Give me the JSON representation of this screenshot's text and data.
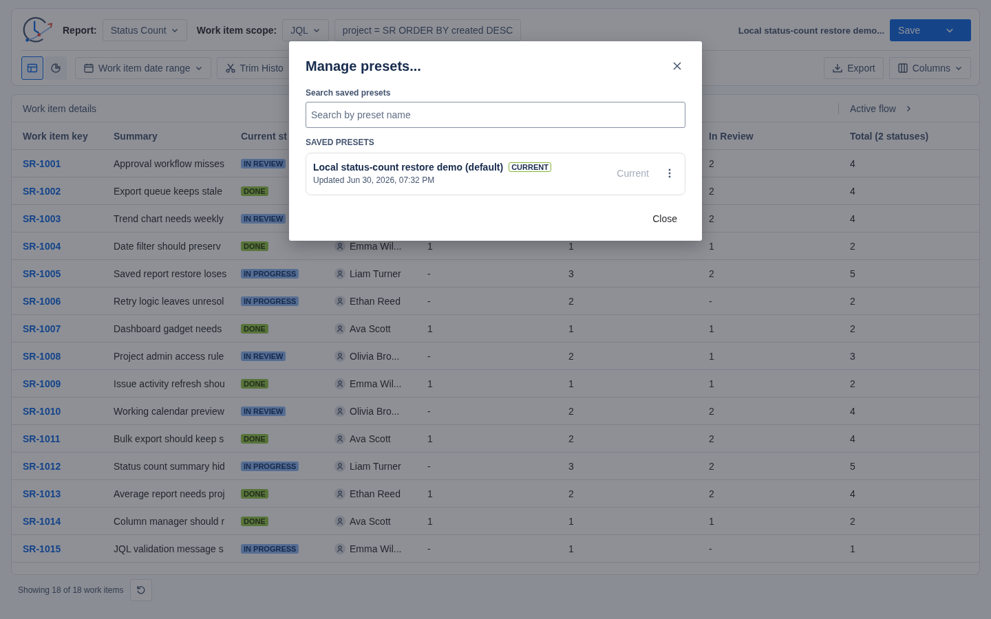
{
  "header": {
    "report_label": "Report:",
    "report": "Status Count",
    "scope_label": "Work item scope:",
    "scope": "JQL",
    "query": "project = SR ORDER BY created DESC",
    "preset_name": "Local status-count restore demo...",
    "save": "Save"
  },
  "toolbar": {
    "views": [
      {
        "kind": "table",
        "selected": true
      },
      {
        "kind": "chart",
        "selected": false
      }
    ],
    "date_range": "Work item date range",
    "trim": "Trim Histo",
    "export": "Export",
    "columns": "Columns"
  },
  "table": {
    "group_headers": [
      "Work item details",
      "Active flow"
    ],
    "columns": {
      "key": "Work item key",
      "summary": "Summary",
      "status": "Current st",
      "in_review": "In Review",
      "total": "Total (2 statuses)"
    },
    "rows": [
      {
        "key": "SR-1001",
        "summary": "Approval workflow misses",
        "status": {
          "label": "IN REVIEW",
          "kind": "review"
        },
        "in_review": "2",
        "total": "4"
      },
      {
        "key": "SR-1002",
        "summary": "Export queue keeps stale",
        "status": {
          "label": "DONE",
          "kind": "done"
        },
        "in_review": "2",
        "total": "4"
      },
      {
        "key": "SR-1003",
        "summary": "Trend chart needs weekly",
        "status": {
          "label": "IN REVIEW",
          "kind": "review"
        },
        "in_review": "2",
        "total": "4"
      },
      {
        "key": "SR-1004",
        "summary": "Date filter should preserv",
        "status": {
          "label": "DONE",
          "kind": "done"
        },
        "assignee": "Emma Wil...",
        "column_5": "1",
        "column_6": "1",
        "in_review": "1",
        "total": "2"
      },
      {
        "key": "SR-1005",
        "summary": "Saved report restore loses",
        "status": {
          "label": "IN PROGRESS",
          "kind": "progress"
        },
        "assignee": "Liam Turner",
        "column_5": "-",
        "column_6": "3",
        "in_review": "2",
        "total": "5"
      },
      {
        "key": "SR-1006",
        "summary": "Retry logic leaves unresol",
        "status": {
          "label": "IN PROGRESS",
          "kind": "progress"
        },
        "assignee": "Ethan Reed",
        "column_5": "-",
        "column_6": "2",
        "in_review": "-",
        "total": "2"
      },
      {
        "key": "SR-1007",
        "summary": "Dashboard gadget needs",
        "status": {
          "label": "DONE",
          "kind": "done"
        },
        "assignee": "Ava Scott",
        "column_5": "1",
        "column_6": "1",
        "in_review": "1",
        "total": "2"
      },
      {
        "key": "SR-1008",
        "summary": "Project admin access rule",
        "status": {
          "label": "IN REVIEW",
          "kind": "review"
        },
        "assignee": "Olivia Bro...",
        "column_5": "-",
        "column_6": "2",
        "in_review": "1",
        "total": "3"
      },
      {
        "key": "SR-1009",
        "summary": "Issue activity refresh shou",
        "status": {
          "label": "DONE",
          "kind": "done"
        },
        "assignee": "Emma Wil...",
        "column_5": "1",
        "column_6": "1",
        "in_review": "1",
        "total": "2"
      },
      {
        "key": "SR-1010",
        "summary": "Working calendar preview",
        "status": {
          "label": "IN REVIEW",
          "kind": "review"
        },
        "assignee": "Olivia Bro...",
        "column_5": "-",
        "column_6": "2",
        "in_review": "2",
        "total": "4"
      },
      {
        "key": "SR-1011",
        "summary": "Bulk export should keep s",
        "status": {
          "label": "DONE",
          "kind": "done"
        },
        "assignee": "Ava Scott",
        "column_5": "1",
        "column_6": "2",
        "in_review": "2",
        "total": "4"
      },
      {
        "key": "SR-1012",
        "summary": "Status count summary hid",
        "status": {
          "label": "IN PROGRESS",
          "kind": "progress"
        },
        "assignee": "Liam Turner",
        "column_5": "-",
        "column_6": "3",
        "in_review": "2",
        "total": "5"
      },
      {
        "key": "SR-1013",
        "summary": "Average report needs proj",
        "status": {
          "label": "DONE",
          "kind": "done"
        },
        "assignee": "Ethan Reed",
        "column_5": "1",
        "column_6": "2",
        "in_review": "2",
        "total": "4"
      },
      {
        "key": "SR-1014",
        "summary": "Column manager should r",
        "status": {
          "label": "DONE",
          "kind": "done"
        },
        "assignee": "Ava Scott",
        "column_5": "1",
        "column_6": "1",
        "in_review": "1",
        "total": "2"
      },
      {
        "key": "SR-1015",
        "summary": "JQL validation message s",
        "status": {
          "label": "IN PROGRESS",
          "kind": "progress"
        },
        "assignee": "Emma Wil...",
        "column_5": "-",
        "column_6": "1",
        "in_review": "-",
        "total": "1"
      }
    ]
  },
  "footer": {
    "showing": "Showing 18 of 18 work items"
  },
  "modal": {
    "title": "Manage presets...",
    "search_label": "Search saved presets",
    "search_placeholder": "Search by preset name",
    "section": "SAVED PRESETS",
    "presets": [
      {
        "name": "Local status-count restore demo (default)",
        "badge": "CURRENT",
        "updated": "Updated Jun 30, 2026, 07:32 PM",
        "action": {
          "label": "Current",
          "disabled": true
        }
      }
    ],
    "close": "Close"
  }
}
